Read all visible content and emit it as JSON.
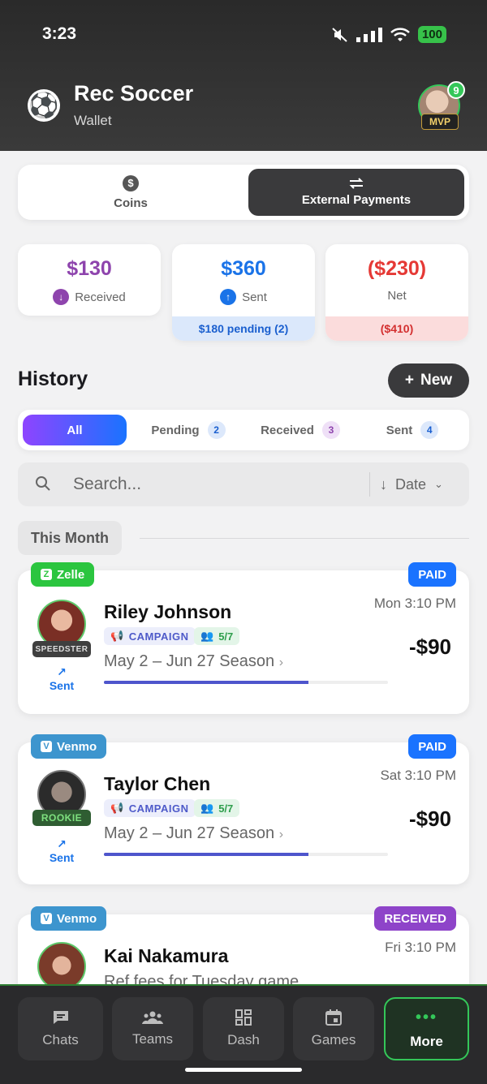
{
  "status_bar": {
    "time": "3:23",
    "battery": "100"
  },
  "header": {
    "title": "Rec Soccer",
    "subtitle": "Wallet",
    "avatar_badge": "9",
    "avatar_tag": "MVP"
  },
  "segment": {
    "coins_label": "Coins",
    "external_label": "External Payments"
  },
  "stats": {
    "received": {
      "value": "$130",
      "label": "Received"
    },
    "sent": {
      "value": "$360",
      "label": "Sent",
      "footer": "$180 pending (2)"
    },
    "net": {
      "value": "($230)",
      "label": "Net",
      "footer": "($410)"
    }
  },
  "history": {
    "title": "History",
    "new_label": "New"
  },
  "filters": [
    {
      "label": "All",
      "count": ""
    },
    {
      "label": "Pending",
      "count": "2"
    },
    {
      "label": "Received",
      "count": "3"
    },
    {
      "label": "Sent",
      "count": "4"
    }
  ],
  "search": {
    "placeholder": "Search...",
    "sort_label": "Date"
  },
  "section": {
    "month_label": "This Month"
  },
  "transactions": [
    {
      "method": "Zelle",
      "status": "PAID",
      "name": "Riley Johnson",
      "time": "Mon 3:10 PM",
      "rank": "SPEEDSTER",
      "direction": "Sent",
      "campaign": "CAMPAIGN",
      "participants": "5/7",
      "season": "May 2 – Jun 27 Season",
      "amount": "-$90",
      "progress": 0.72
    },
    {
      "method": "Venmo",
      "status": "PAID",
      "name": "Taylor Chen",
      "time": "Sat 3:10 PM",
      "rank": "ROOKIE",
      "direction": "Sent",
      "campaign": "CAMPAIGN",
      "participants": "5/7",
      "season": "May 2 – Jun 27 Season",
      "amount": "-$90",
      "progress": 0.72
    },
    {
      "method": "Venmo",
      "status": "RECEIVED",
      "name": "Kai Nakamura",
      "time": "Fri 3:10 PM",
      "description": "Ref fees for Tuesday game"
    }
  ],
  "nav": [
    {
      "label": "Chats",
      "icon": "chat-icon"
    },
    {
      "label": "Teams",
      "icon": "teams-icon"
    },
    {
      "label": "Dash",
      "icon": "dashboard-icon"
    },
    {
      "label": "Games",
      "icon": "calendar-icon"
    },
    {
      "label": "More",
      "icon": "more-icon"
    }
  ],
  "colors": {
    "received_purple": "#8e44ad",
    "sent_blue": "#1a73e8",
    "net_red": "#e53935",
    "zelle_green": "#2bc53f",
    "venmo_blue": "#3d95ce",
    "paid_blue": "#1a73ff",
    "received_status_purple": "#8e44c9"
  }
}
